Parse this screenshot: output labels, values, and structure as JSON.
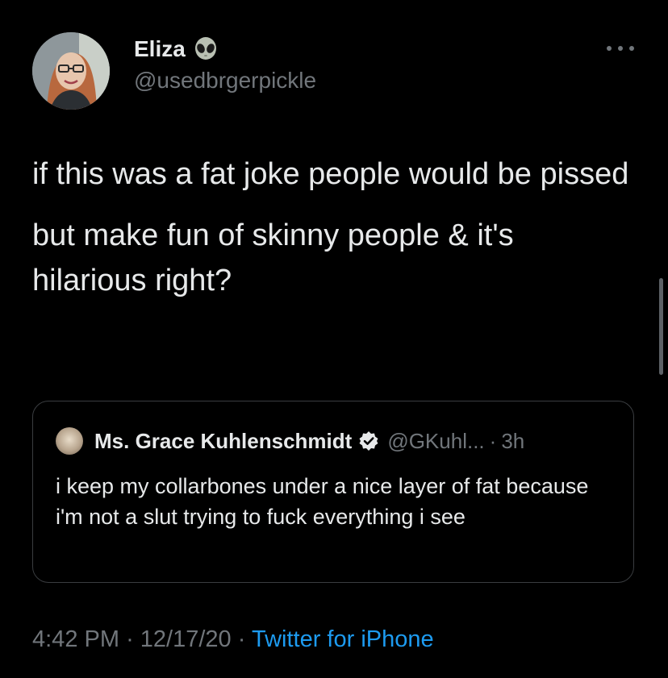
{
  "author": {
    "name": "Eliza",
    "handle": "@usedbrgerpickle",
    "name_emoji": "alien-icon"
  },
  "tweet": {
    "paragraphs": [
      "if this was a fat joke people would be pissed",
      "but make fun of skinny people & it's hilarious right?"
    ]
  },
  "quoted_tweet": {
    "name": "Ms. Grace Kuhlenschmidt",
    "handle": "@GKuhl...",
    "separator": "·",
    "time": "3h",
    "text": "i keep my collarbones under a nice layer of fat because i'm not a slut trying to fuck everything i see"
  },
  "meta": {
    "time": "4:42 PM",
    "separator1": "·",
    "date": "12/17/20",
    "separator2": "·",
    "source": "Twitter for iPhone"
  },
  "colors": {
    "background": "#000000",
    "primary_text": "#e7e9ea",
    "secondary_text": "#71767b",
    "link": "#1d9bf0",
    "border": "#3a3d40"
  },
  "icons": {
    "more": "more-icon",
    "verified": "verified-icon"
  }
}
